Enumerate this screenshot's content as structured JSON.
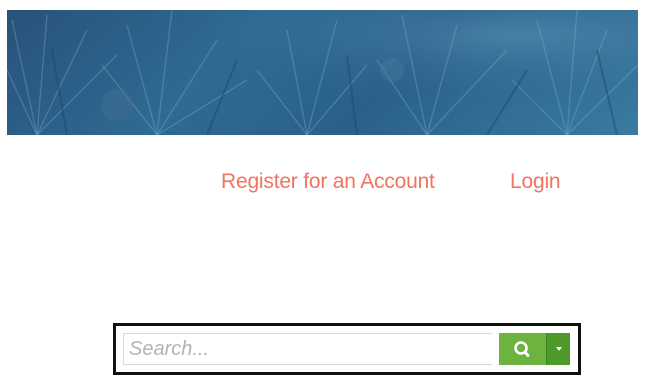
{
  "header": {
    "banner_image": "palm-fronds-banner",
    "banner_color": "#2f6a92"
  },
  "nav": {
    "register_label": "Register for an Account",
    "login_label": "Login",
    "link_color": "#f2735e"
  },
  "search": {
    "placeholder": "Search...",
    "button_icon": "search-icon",
    "dropdown_icon": "caret-down-icon",
    "button_color": "#6cb33f"
  }
}
